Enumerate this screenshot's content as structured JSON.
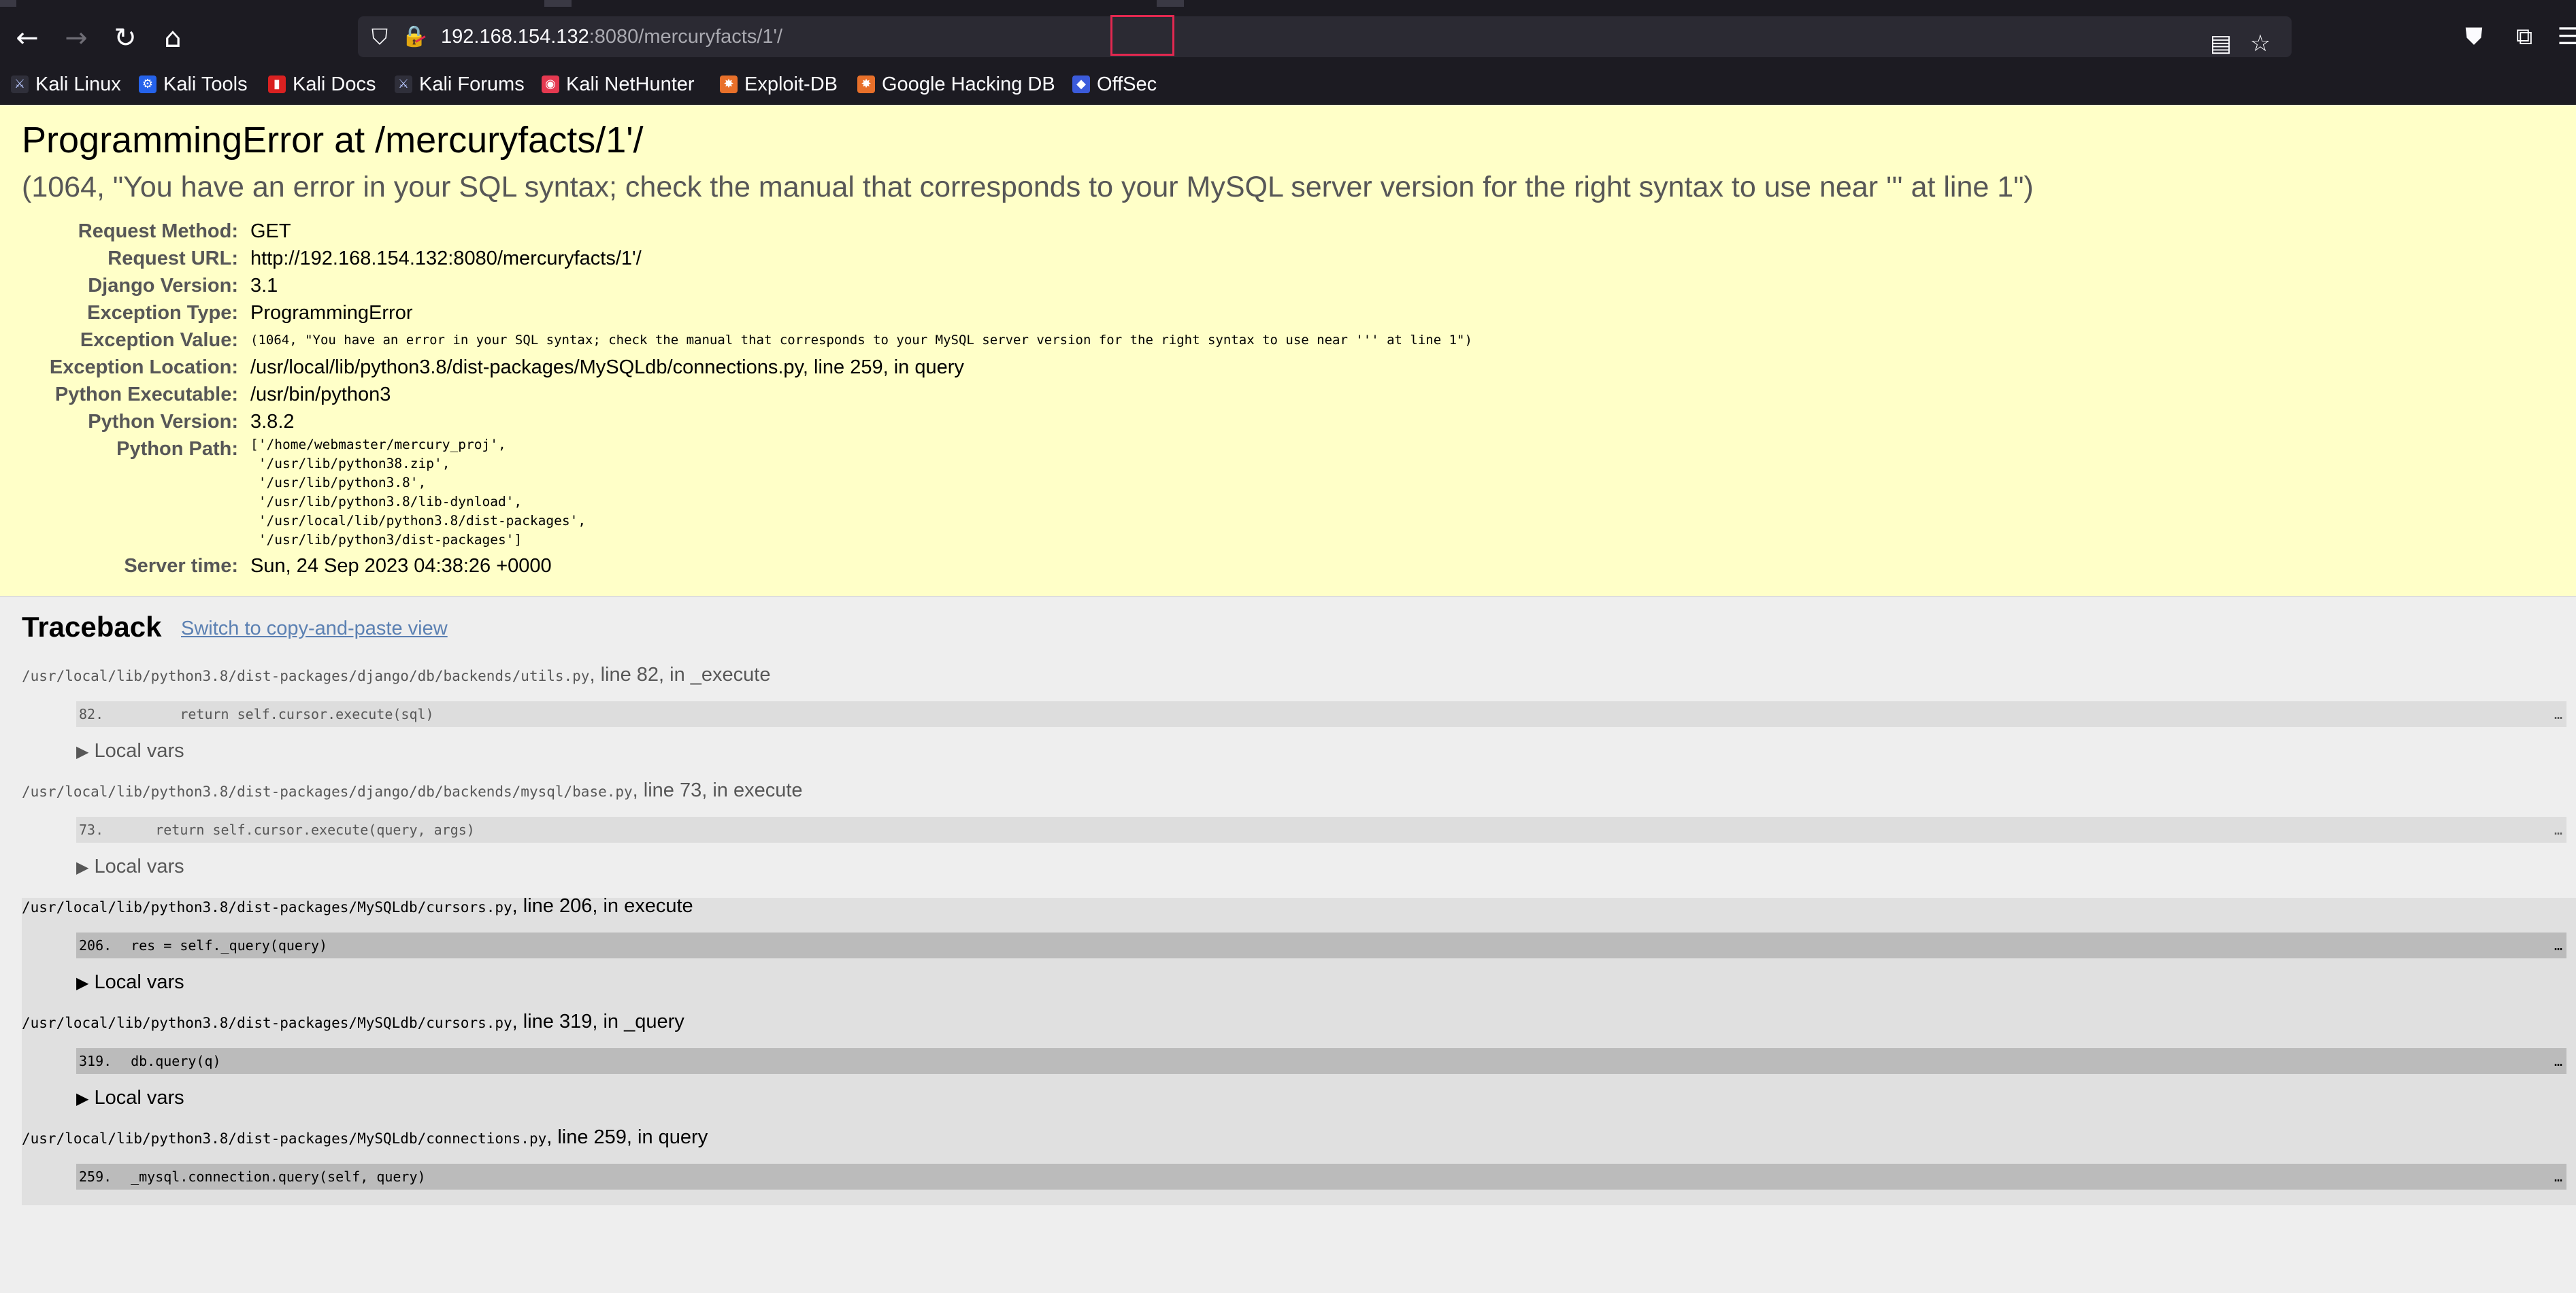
{
  "browser": {
    "url_host": "192.168.154.132",
    "url_rest": ":8080/mercuryfacts/1'/",
    "nav": {
      "back_icon": "arrow-left-icon",
      "forward_icon": "arrow-right-icon",
      "reload_icon": "reload-icon",
      "home_icon": "home-icon"
    },
    "bookmarks": [
      {
        "label": "Kali Linux",
        "icon": "kali-dragon-icon"
      },
      {
        "label": "Kali Tools",
        "icon": "kali-tools-icon"
      },
      {
        "label": "Kali Docs",
        "icon": "kali-docs-icon"
      },
      {
        "label": "Kali Forums",
        "icon": "kali-dragon-icon"
      },
      {
        "label": "Kali NetHunter",
        "icon": "nethunter-icon"
      },
      {
        "label": "Exploit-DB",
        "icon": "exploit-db-icon"
      },
      {
        "label": "Google Hacking DB",
        "icon": "ghdb-icon"
      },
      {
        "label": "OffSec",
        "icon": "offsec-icon"
      }
    ]
  },
  "summary": {
    "title": "ProgrammingError at /mercuryfacts/1'/",
    "message": "(1064, \"You have an error in your SQL syntax; check the manual that corresponds to your MySQL server version for the right syntax to use near ''' at line 1\")",
    "rows": [
      {
        "key": "Request Method:",
        "value": "GET"
      },
      {
        "key": "Request URL:",
        "value": "http://192.168.154.132:8080/mercuryfacts/1'/"
      },
      {
        "key": "Django Version:",
        "value": "3.1"
      },
      {
        "key": "Exception Type:",
        "value": "ProgrammingError"
      },
      {
        "key": "Exception Value:",
        "value": "(1064, \"You have an error in your SQL syntax; check the manual that corresponds to your MySQL server version for the right syntax to use near ''' at line 1\")"
      },
      {
        "key": "Exception Location:",
        "value": "/usr/local/lib/python3.8/dist-packages/MySQLdb/connections.py, line 259, in query"
      },
      {
        "key": "Python Executable:",
        "value": "/usr/bin/python3"
      },
      {
        "key": "Python Version:",
        "value": "3.8.2"
      }
    ],
    "python_path_key": "Python Path:",
    "python_path": "['/home/webmaster/mercury_proj',\n '/usr/lib/python38.zip',\n '/usr/lib/python3.8',\n '/usr/lib/python3.8/lib-dynload',\n '/usr/local/lib/python3.8/dist-packages',\n '/usr/lib/python3/dist-packages']",
    "server_time_key": "Server time:",
    "server_time": "Sun, 24 Sep 2023 04:38:26 +0000"
  },
  "traceback": {
    "title": "Traceback",
    "switch_link": "Switch to copy-and-paste view",
    "local_vars_label": "Local vars",
    "frames": [
      {
        "file": "/usr/local/lib/python3.8/dist-packages/django/db/backends/utils.py",
        "loc": ", line 82, in _execute",
        "lineno": "82.",
        "code": "        return self.cursor.execute(sql)",
        "ellipsis": "…"
      },
      {
        "file": "/usr/local/lib/python3.8/dist-packages/django/db/backends/mysql/base.py",
        "loc": ", line 73, in execute",
        "lineno": "73.",
        "code": "     return self.cursor.execute(query, args)",
        "ellipsis": "…"
      },
      {
        "file": "/usr/local/lib/python3.8/dist-packages/MySQLdb/cursors.py",
        "loc": ", line 206, in execute",
        "lineno": "206.",
        "code": "  res = self._query(query)",
        "ellipsis": "…"
      },
      {
        "file": "/usr/local/lib/python3.8/dist-packages/MySQLdb/cursors.py",
        "loc": ", line 319, in _query",
        "lineno": "319.",
        "code": "  db.query(q)",
        "ellipsis": "…"
      },
      {
        "file": "/usr/local/lib/python3.8/dist-packages/MySQLdb/connections.py",
        "loc": ", line 259, in query",
        "lineno": "259.",
        "code": "  _mysql.connection.query(self, query)",
        "ellipsis": "…"
      }
    ]
  },
  "colors": {
    "summary_bg": "#ffffc8",
    "traceback_bg": "#eeeeee",
    "link": "#5b80b2",
    "url_highlight": "#e22850"
  }
}
